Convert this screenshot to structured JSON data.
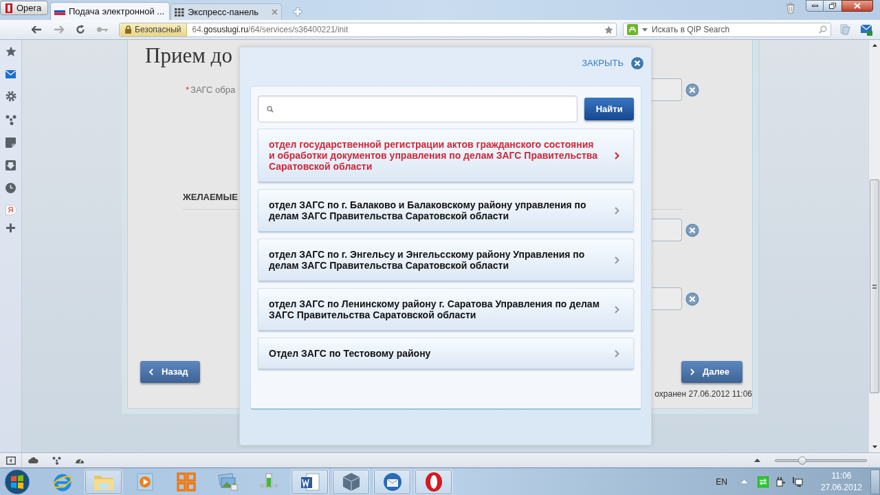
{
  "browser": {
    "menu_button": "Opera",
    "tabs": [
      {
        "title": "Подача электронной ...",
        "selected": true,
        "kind": "page"
      },
      {
        "title": "Экспресс-панель",
        "selected": false,
        "kind": "speed_dial"
      }
    ]
  },
  "address_bar": {
    "security_label": "Безопасный",
    "url": "64.**gosuslugi.ru**/64/services/s36400221/init"
  },
  "search": {
    "placeholder": "Искать в QIP Search"
  },
  "side_panel": {
    "badge": "Я"
  },
  "page": {
    "heading": "Прием до",
    "required_mark": "*",
    "field_label": "ЗАГС обра",
    "section_title": "ЖЕЛАЕМЫЕ",
    "back_button": "Назад",
    "next_button": "Далее",
    "saved_note": "охранен 27.06.2012 11:06"
  },
  "modal": {
    "close_label": "ЗАКРЫТЬ",
    "search_button": "Найти",
    "items": [
      {
        "text": "отдел государственной регистрации актов гражданского состояния и обработки документов управления по делам ЗАГС Правительства Саратовской области",
        "selected": true
      },
      {
        "text": "отдел ЗАГС по г. Балаково и Балаковскому району управления по делам ЗАГС Правительства Саратовской области",
        "selected": false
      },
      {
        "text": "отдел ЗАГС по г. Энгельсу и Энгельсскому району Управления по делам ЗАГС Правительства Саратовской области",
        "selected": false
      },
      {
        "text": "отдел ЗАГС по Ленинскому району г. Саратова Управления по делам ЗАГС Правительства Саратовской области",
        "selected": false
      },
      {
        "text": "Отдел ЗАГС по Тестовому району",
        "selected": false
      }
    ]
  },
  "status_bar": {
    "zoom": {
      "level": 0.3
    }
  },
  "taskbar": {
    "apps": [
      {
        "kind": "browser",
        "running": false
      },
      {
        "kind": "folder",
        "running": true
      },
      {
        "kind": "player",
        "running": false
      },
      {
        "kind": "tiles",
        "running": false
      },
      {
        "kind": "pictures",
        "running": false
      },
      {
        "kind": "phone",
        "running": false
      },
      {
        "kind": "document",
        "running": true
      },
      {
        "kind": "cube",
        "running": true
      },
      {
        "kind": "mail",
        "running": true
      },
      {
        "kind": "opera",
        "running": true
      }
    ],
    "language": "EN",
    "time": "11:06",
    "date": "27.06.2012"
  }
}
